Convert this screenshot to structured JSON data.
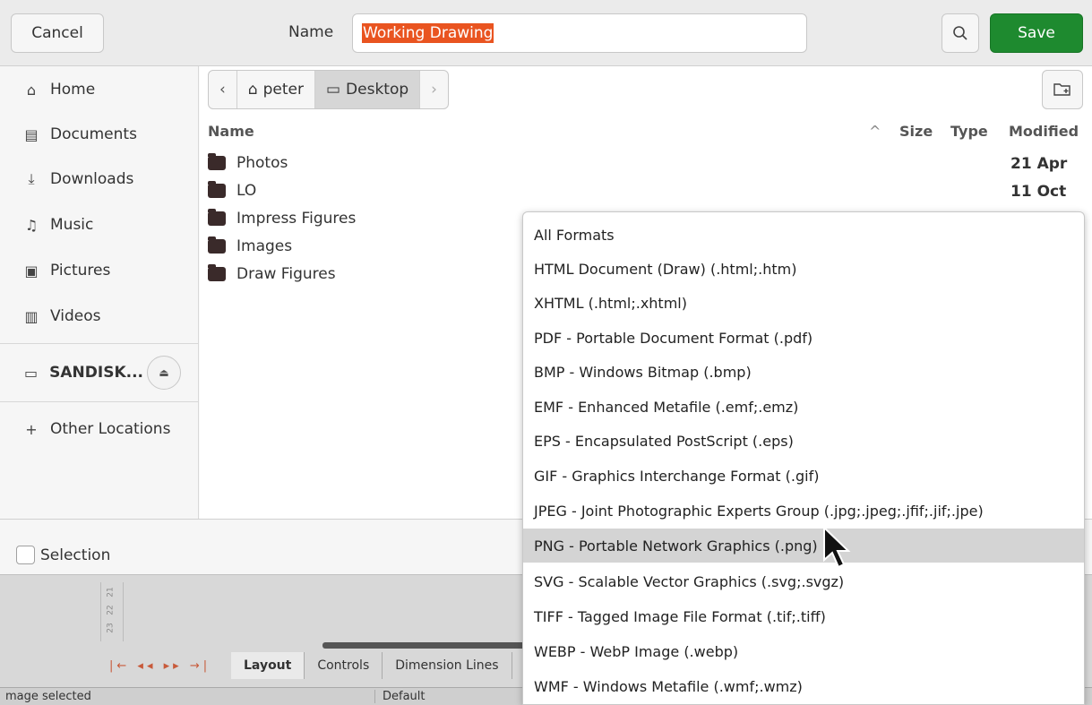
{
  "header": {
    "cancel_label": "Cancel",
    "name_label": "Name",
    "name_value": "Working Drawing",
    "save_label": "Save"
  },
  "sidebar": {
    "items": [
      {
        "label": "Home",
        "icon": "home-icon"
      },
      {
        "label": "Documents",
        "icon": "document-icon"
      },
      {
        "label": "Downloads",
        "icon": "download-icon"
      },
      {
        "label": "Music",
        "icon": "music-icon"
      },
      {
        "label": "Pictures",
        "icon": "picture-icon"
      },
      {
        "label": "Videos",
        "icon": "video-icon"
      },
      {
        "label": "SANDISK...",
        "icon": "drive-icon"
      },
      {
        "label": "Other Locations",
        "icon": "plus-icon"
      }
    ]
  },
  "pathbar": {
    "segments": [
      "peter",
      "Desktop"
    ]
  },
  "columns": {
    "name": "Name",
    "size": "Size",
    "type": "Type",
    "modified": "Modified"
  },
  "files": [
    {
      "name": "Photos",
      "modified": "21 Apr"
    },
    {
      "name": "LO",
      "modified": "11 Oct"
    },
    {
      "name": "Impress Figures",
      "modified": ""
    },
    {
      "name": "Images",
      "modified": ""
    },
    {
      "name": "Draw Figures",
      "modified": ""
    }
  ],
  "bottom": {
    "selection_label": "Selection"
  },
  "formats": [
    "All Formats",
    "HTML Document (Draw) (.html;.htm)",
    "XHTML (.html;.xhtml)",
    "PDF - Portable Document Format (.pdf)",
    "BMP - Windows Bitmap (.bmp)",
    "EMF - Enhanced Metafile (.emf;.emz)",
    "EPS - Encapsulated PostScript (.eps)",
    "GIF - Graphics Interchange Format (.gif)",
    "JPEG - Joint Photographic Experts Group (.jpg;.jpeg;.jfif;.jif;.jpe)",
    "PNG - Portable Network Graphics (.png)",
    "SVG - Scalable Vector Graphics (.svg;.svgz)",
    "TIFF - Tagged Image File Format (.tif;.tiff)",
    "WEBP - WebP Image (.webp)",
    "WMF - Windows Metafile (.wmf;.wmz)"
  ],
  "background_app": {
    "ruler": [
      "21",
      "22",
      "23"
    ],
    "tabs": [
      "Layout",
      "Controls",
      "Dimension Lines"
    ],
    "status_left": "mage selected",
    "status_mid": "Default"
  },
  "colors": {
    "save": "#1e8a2f",
    "selection": "#e95420",
    "highlight": "#d4d4d4"
  }
}
